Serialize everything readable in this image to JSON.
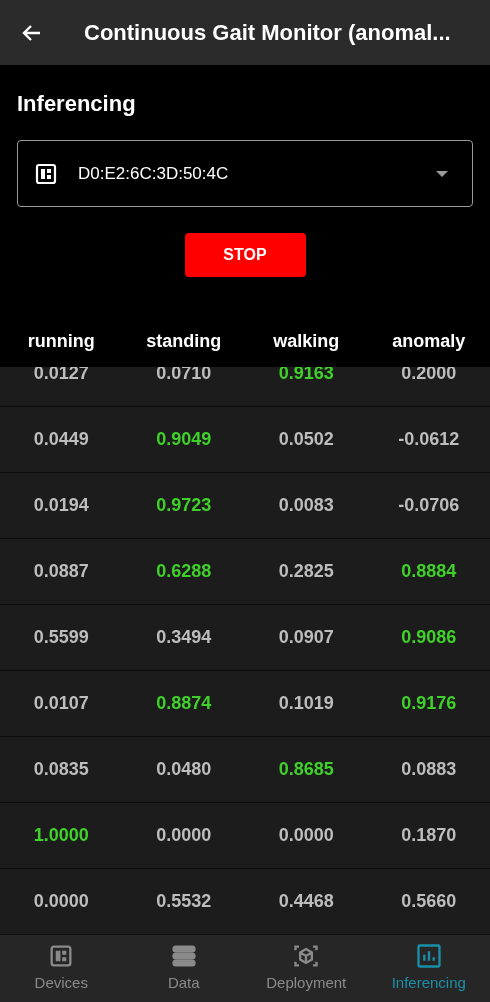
{
  "app_bar": {
    "title": "Continuous Gait Monitor (anomal..."
  },
  "section_title": "Inferencing",
  "device_select": {
    "value": "D0:E2:6C:3D:50:4C"
  },
  "stop_button": "STOP",
  "table": {
    "columns": [
      "running",
      "standing",
      "walking",
      "anomaly"
    ],
    "rows": [
      {
        "cells": [
          {
            "value": "0.0127",
            "highlighted": false
          },
          {
            "value": "0.0710",
            "highlighted": false
          },
          {
            "value": "0.9163",
            "highlighted": true
          },
          {
            "value": "0.2000",
            "highlighted": false
          }
        ]
      },
      {
        "cells": [
          {
            "value": "0.0449",
            "highlighted": false
          },
          {
            "value": "0.9049",
            "highlighted": true
          },
          {
            "value": "0.0502",
            "highlighted": false
          },
          {
            "value": "-0.0612",
            "highlighted": false
          }
        ]
      },
      {
        "cells": [
          {
            "value": "0.0194",
            "highlighted": false
          },
          {
            "value": "0.9723",
            "highlighted": true
          },
          {
            "value": "0.0083",
            "highlighted": false
          },
          {
            "value": "-0.0706",
            "highlighted": false
          }
        ]
      },
      {
        "cells": [
          {
            "value": "0.0887",
            "highlighted": false
          },
          {
            "value": "0.6288",
            "highlighted": true
          },
          {
            "value": "0.2825",
            "highlighted": false
          },
          {
            "value": "0.8884",
            "highlighted": true
          }
        ]
      },
      {
        "cells": [
          {
            "value": "0.5599",
            "highlighted": false
          },
          {
            "value": "0.3494",
            "highlighted": false
          },
          {
            "value": "0.0907",
            "highlighted": false
          },
          {
            "value": "0.9086",
            "highlighted": true
          }
        ]
      },
      {
        "cells": [
          {
            "value": "0.0107",
            "highlighted": false
          },
          {
            "value": "0.8874",
            "highlighted": true
          },
          {
            "value": "0.1019",
            "highlighted": false
          },
          {
            "value": "0.9176",
            "highlighted": true
          }
        ]
      },
      {
        "cells": [
          {
            "value": "0.0835",
            "highlighted": false
          },
          {
            "value": "0.0480",
            "highlighted": false
          },
          {
            "value": "0.8685",
            "highlighted": true
          },
          {
            "value": "0.0883",
            "highlighted": false
          }
        ]
      },
      {
        "cells": [
          {
            "value": "1.0000",
            "highlighted": true
          },
          {
            "value": "0.0000",
            "highlighted": false
          },
          {
            "value": "0.0000",
            "highlighted": false
          },
          {
            "value": "0.1870",
            "highlighted": false
          }
        ]
      },
      {
        "cells": [
          {
            "value": "0.0000",
            "highlighted": false
          },
          {
            "value": "0.5532",
            "highlighted": false
          },
          {
            "value": "0.4468",
            "highlighted": false
          },
          {
            "value": "0.5660",
            "highlighted": false
          }
        ]
      }
    ]
  },
  "bottom_nav": [
    {
      "kind": "devices",
      "label": "Devices",
      "selected": false
    },
    {
      "kind": "data",
      "label": "Data",
      "selected": false
    },
    {
      "kind": "deployment",
      "label": "Deployment",
      "selected": false
    },
    {
      "kind": "inferencing",
      "label": "Inferencing",
      "selected": true
    }
  ]
}
